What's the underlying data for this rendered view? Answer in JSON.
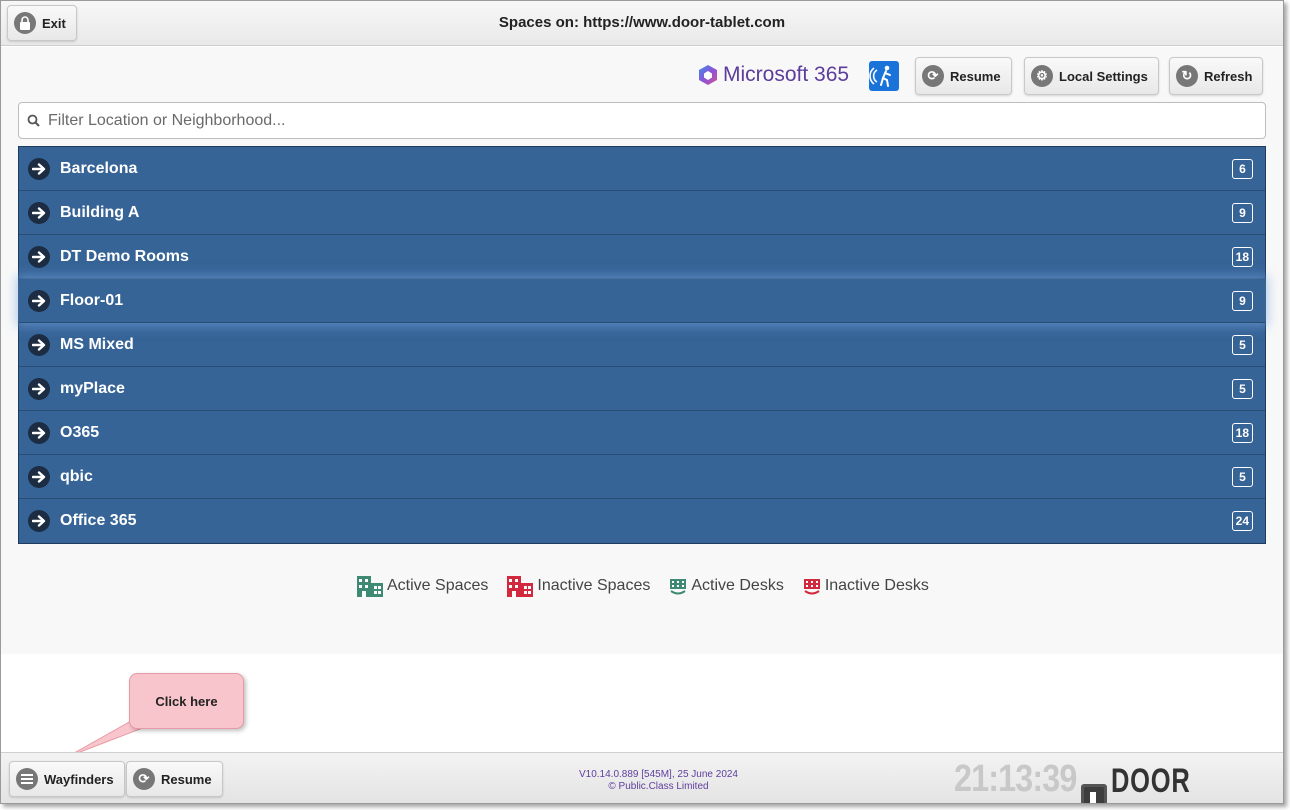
{
  "header": {
    "title": "Spaces on: https://www.door-tablet.com",
    "exit_label": "Exit"
  },
  "toolbar": {
    "ms365_label": "Microsoft 365",
    "resume_label": "Resume",
    "local_settings_label": "Local Settings",
    "refresh_label": "Refresh"
  },
  "search": {
    "placeholder": "Filter Location or Neighborhood..."
  },
  "locations": [
    {
      "name": "Barcelona",
      "count": "6"
    },
    {
      "name": "Building A",
      "count": "9"
    },
    {
      "name": "DT Demo Rooms",
      "count": "18"
    },
    {
      "name": "Floor-01",
      "count": "9"
    },
    {
      "name": "MS Mixed",
      "count": "5"
    },
    {
      "name": "myPlace",
      "count": "5"
    },
    {
      "name": "O365",
      "count": "18"
    },
    {
      "name": "qbic",
      "count": "5"
    },
    {
      "name": "Office 365",
      "count": "24"
    }
  ],
  "legend": {
    "active_spaces": "Active Spaces",
    "inactive_spaces": "Inactive Spaces",
    "active_desks": "Active Desks",
    "inactive_desks": "Inactive Desks"
  },
  "footer": {
    "wayfinders_label": "Wayfinders",
    "resume_label": "Resume",
    "version": "V10.14.0.889 [545M], 25 June 2024",
    "copyright": "© Public.Class Limited",
    "clock": "21:13:39",
    "brand": "DOOR TABLET"
  },
  "annotation": {
    "callout_text": "Click here"
  },
  "colors": {
    "row_bg": "#376497",
    "active_green": "#3f8a72",
    "inactive_red": "#d2293f",
    "accent_purple": "#5c3d9b"
  },
  "icons": {
    "exit": "lock-icon",
    "resume": "sync-icon",
    "settings": "gear-icon",
    "refresh": "refresh-icon",
    "search": "search-icon",
    "row": "arrow-right-icon",
    "wayfinders": "hamburger-menu-icon",
    "accessibility": "accessibility-icon"
  }
}
